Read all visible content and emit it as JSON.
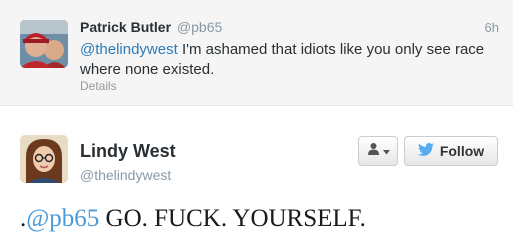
{
  "reply": {
    "author_name": "Patrick Butler",
    "author_handle": "@pb65",
    "time": "6h",
    "mention": "@thelindywest",
    "text": " I'm ashamed that idiots like you only see race where none existed.",
    "details_label": "Details"
  },
  "main": {
    "author_name": "Lindy West",
    "author_handle": "@thelindywest",
    "follow_label": "Follow",
    "text_prefix": ".",
    "mention": "@pb65",
    "text": " GO. FUCK. YOURSELF."
  },
  "colors": {
    "link": "#2b7bb9",
    "twitter_bird": "#55acee"
  }
}
